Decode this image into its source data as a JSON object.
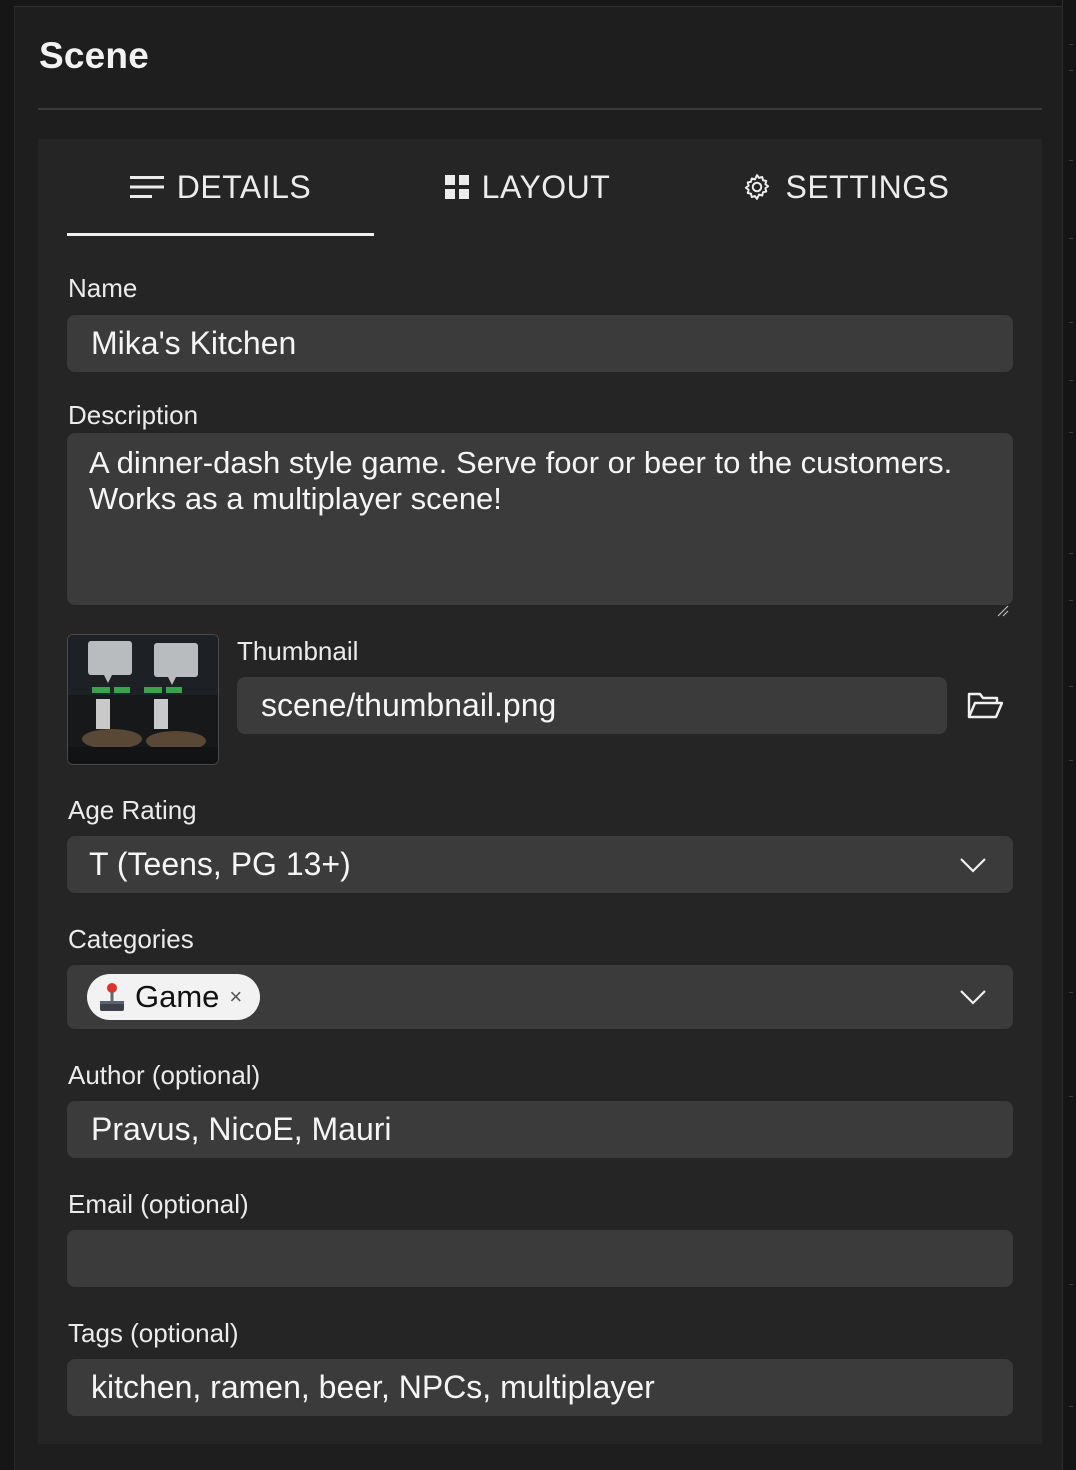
{
  "panel": {
    "title": "Scene"
  },
  "tabs": [
    {
      "label": "DETAILS",
      "icon": "menu-lines-icon",
      "active": true
    },
    {
      "label": "LAYOUT",
      "icon": "grid-icon",
      "active": false
    },
    {
      "label": "SETTINGS",
      "icon": "gear-icon",
      "active": false
    }
  ],
  "details": {
    "name": {
      "label": "Name",
      "value": "Mika's Kitchen"
    },
    "description": {
      "label": "Description",
      "value": "A dinner-dash style game. Serve foor or beer to the customers. Works as a multiplayer scene!"
    },
    "thumbnail": {
      "label": "Thumbnail",
      "value": "scene/thumbnail.png",
      "browse_icon": "folder-open-icon"
    },
    "age_rating": {
      "label": "Age Rating",
      "value": "T (Teens, PG 13+)",
      "icon": "chevron-down-icon"
    },
    "categories": {
      "label": "Categories",
      "chips": [
        {
          "label": "Game",
          "icon": "joystick-icon",
          "remove": "×"
        }
      ],
      "icon": "chevron-down-icon"
    },
    "author": {
      "label": "Author (optional)",
      "value": "Pravus, NicoE, Mauri"
    },
    "email": {
      "label": "Email (optional)",
      "value": ""
    },
    "tags": {
      "label": "Tags (optional)",
      "value": "kitchen, ramen, beer, NPCs, multiplayer"
    }
  },
  "colors": {
    "background": "#1e1e1e",
    "card": "#252525",
    "field": "#3b3b3b",
    "text": "#f5f5f5",
    "chip": "#f2f2f2"
  }
}
